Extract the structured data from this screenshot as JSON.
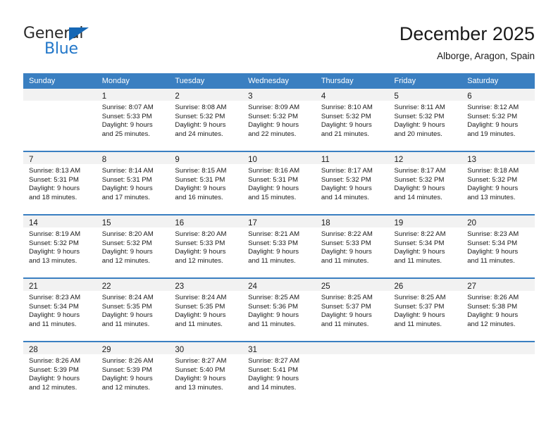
{
  "brand": {
    "name_part1": "General",
    "name_part2": "Blue",
    "triangle_color": "#1567b5",
    "blue_text_color": "#2277c9"
  },
  "header": {
    "title": "December 2025",
    "subtitle": "Alborge, Aragon, Spain"
  },
  "theme": {
    "header_blue": "#3a7fc1",
    "daynum_band": "#f2f2f2",
    "text": "#1a1a1a"
  },
  "weekday_headers": [
    "Sunday",
    "Monday",
    "Tuesday",
    "Wednesday",
    "Thursday",
    "Friday",
    "Saturday"
  ],
  "weeks": [
    [
      {
        "day": "",
        "sunrise": "",
        "sunset": "",
        "daylight_line1": "",
        "daylight_line2": ""
      },
      {
        "day": "1",
        "sunrise": "Sunrise: 8:07 AM",
        "sunset": "Sunset: 5:33 PM",
        "daylight_line1": "Daylight: 9 hours",
        "daylight_line2": "and 25 minutes."
      },
      {
        "day": "2",
        "sunrise": "Sunrise: 8:08 AM",
        "sunset": "Sunset: 5:32 PM",
        "daylight_line1": "Daylight: 9 hours",
        "daylight_line2": "and 24 minutes."
      },
      {
        "day": "3",
        "sunrise": "Sunrise: 8:09 AM",
        "sunset": "Sunset: 5:32 PM",
        "daylight_line1": "Daylight: 9 hours",
        "daylight_line2": "and 22 minutes."
      },
      {
        "day": "4",
        "sunrise": "Sunrise: 8:10 AM",
        "sunset": "Sunset: 5:32 PM",
        "daylight_line1": "Daylight: 9 hours",
        "daylight_line2": "and 21 minutes."
      },
      {
        "day": "5",
        "sunrise": "Sunrise: 8:11 AM",
        "sunset": "Sunset: 5:32 PM",
        "daylight_line1": "Daylight: 9 hours",
        "daylight_line2": "and 20 minutes."
      },
      {
        "day": "6",
        "sunrise": "Sunrise: 8:12 AM",
        "sunset": "Sunset: 5:32 PM",
        "daylight_line1": "Daylight: 9 hours",
        "daylight_line2": "and 19 minutes."
      }
    ],
    [
      {
        "day": "7",
        "sunrise": "Sunrise: 8:13 AM",
        "sunset": "Sunset: 5:31 PM",
        "daylight_line1": "Daylight: 9 hours",
        "daylight_line2": "and 18 minutes."
      },
      {
        "day": "8",
        "sunrise": "Sunrise: 8:14 AM",
        "sunset": "Sunset: 5:31 PM",
        "daylight_line1": "Daylight: 9 hours",
        "daylight_line2": "and 17 minutes."
      },
      {
        "day": "9",
        "sunrise": "Sunrise: 8:15 AM",
        "sunset": "Sunset: 5:31 PM",
        "daylight_line1": "Daylight: 9 hours",
        "daylight_line2": "and 16 minutes."
      },
      {
        "day": "10",
        "sunrise": "Sunrise: 8:16 AM",
        "sunset": "Sunset: 5:31 PM",
        "daylight_line1": "Daylight: 9 hours",
        "daylight_line2": "and 15 minutes."
      },
      {
        "day": "11",
        "sunrise": "Sunrise: 8:17 AM",
        "sunset": "Sunset: 5:32 PM",
        "daylight_line1": "Daylight: 9 hours",
        "daylight_line2": "and 14 minutes."
      },
      {
        "day": "12",
        "sunrise": "Sunrise: 8:17 AM",
        "sunset": "Sunset: 5:32 PM",
        "daylight_line1": "Daylight: 9 hours",
        "daylight_line2": "and 14 minutes."
      },
      {
        "day": "13",
        "sunrise": "Sunrise: 8:18 AM",
        "sunset": "Sunset: 5:32 PM",
        "daylight_line1": "Daylight: 9 hours",
        "daylight_line2": "and 13 minutes."
      }
    ],
    [
      {
        "day": "14",
        "sunrise": "Sunrise: 8:19 AM",
        "sunset": "Sunset: 5:32 PM",
        "daylight_line1": "Daylight: 9 hours",
        "daylight_line2": "and 13 minutes."
      },
      {
        "day": "15",
        "sunrise": "Sunrise: 8:20 AM",
        "sunset": "Sunset: 5:32 PM",
        "daylight_line1": "Daylight: 9 hours",
        "daylight_line2": "and 12 minutes."
      },
      {
        "day": "16",
        "sunrise": "Sunrise: 8:20 AM",
        "sunset": "Sunset: 5:33 PM",
        "daylight_line1": "Daylight: 9 hours",
        "daylight_line2": "and 12 minutes."
      },
      {
        "day": "17",
        "sunrise": "Sunrise: 8:21 AM",
        "sunset": "Sunset: 5:33 PM",
        "daylight_line1": "Daylight: 9 hours",
        "daylight_line2": "and 11 minutes."
      },
      {
        "day": "18",
        "sunrise": "Sunrise: 8:22 AM",
        "sunset": "Sunset: 5:33 PM",
        "daylight_line1": "Daylight: 9 hours",
        "daylight_line2": "and 11 minutes."
      },
      {
        "day": "19",
        "sunrise": "Sunrise: 8:22 AM",
        "sunset": "Sunset: 5:34 PM",
        "daylight_line1": "Daylight: 9 hours",
        "daylight_line2": "and 11 minutes."
      },
      {
        "day": "20",
        "sunrise": "Sunrise: 8:23 AM",
        "sunset": "Sunset: 5:34 PM",
        "daylight_line1": "Daylight: 9 hours",
        "daylight_line2": "and 11 minutes."
      }
    ],
    [
      {
        "day": "21",
        "sunrise": "Sunrise: 8:23 AM",
        "sunset": "Sunset: 5:34 PM",
        "daylight_line1": "Daylight: 9 hours",
        "daylight_line2": "and 11 minutes."
      },
      {
        "day": "22",
        "sunrise": "Sunrise: 8:24 AM",
        "sunset": "Sunset: 5:35 PM",
        "daylight_line1": "Daylight: 9 hours",
        "daylight_line2": "and 11 minutes."
      },
      {
        "day": "23",
        "sunrise": "Sunrise: 8:24 AM",
        "sunset": "Sunset: 5:35 PM",
        "daylight_line1": "Daylight: 9 hours",
        "daylight_line2": "and 11 minutes."
      },
      {
        "day": "24",
        "sunrise": "Sunrise: 8:25 AM",
        "sunset": "Sunset: 5:36 PM",
        "daylight_line1": "Daylight: 9 hours",
        "daylight_line2": "and 11 minutes."
      },
      {
        "day": "25",
        "sunrise": "Sunrise: 8:25 AM",
        "sunset": "Sunset: 5:37 PM",
        "daylight_line1": "Daylight: 9 hours",
        "daylight_line2": "and 11 minutes."
      },
      {
        "day": "26",
        "sunrise": "Sunrise: 8:25 AM",
        "sunset": "Sunset: 5:37 PM",
        "daylight_line1": "Daylight: 9 hours",
        "daylight_line2": "and 11 minutes."
      },
      {
        "day": "27",
        "sunrise": "Sunrise: 8:26 AM",
        "sunset": "Sunset: 5:38 PM",
        "daylight_line1": "Daylight: 9 hours",
        "daylight_line2": "and 12 minutes."
      }
    ],
    [
      {
        "day": "28",
        "sunrise": "Sunrise: 8:26 AM",
        "sunset": "Sunset: 5:39 PM",
        "daylight_line1": "Daylight: 9 hours",
        "daylight_line2": "and 12 minutes."
      },
      {
        "day": "29",
        "sunrise": "Sunrise: 8:26 AM",
        "sunset": "Sunset: 5:39 PM",
        "daylight_line1": "Daylight: 9 hours",
        "daylight_line2": "and 12 minutes."
      },
      {
        "day": "30",
        "sunrise": "Sunrise: 8:27 AM",
        "sunset": "Sunset: 5:40 PM",
        "daylight_line1": "Daylight: 9 hours",
        "daylight_line2": "and 13 minutes."
      },
      {
        "day": "31",
        "sunrise": "Sunrise: 8:27 AM",
        "sunset": "Sunset: 5:41 PM",
        "daylight_line1": "Daylight: 9 hours",
        "daylight_line2": "and 14 minutes."
      },
      {
        "day": "",
        "sunrise": "",
        "sunset": "",
        "daylight_line1": "",
        "daylight_line2": ""
      },
      {
        "day": "",
        "sunrise": "",
        "sunset": "",
        "daylight_line1": "",
        "daylight_line2": ""
      },
      {
        "day": "",
        "sunrise": "",
        "sunset": "",
        "daylight_line1": "",
        "daylight_line2": ""
      }
    ]
  ]
}
